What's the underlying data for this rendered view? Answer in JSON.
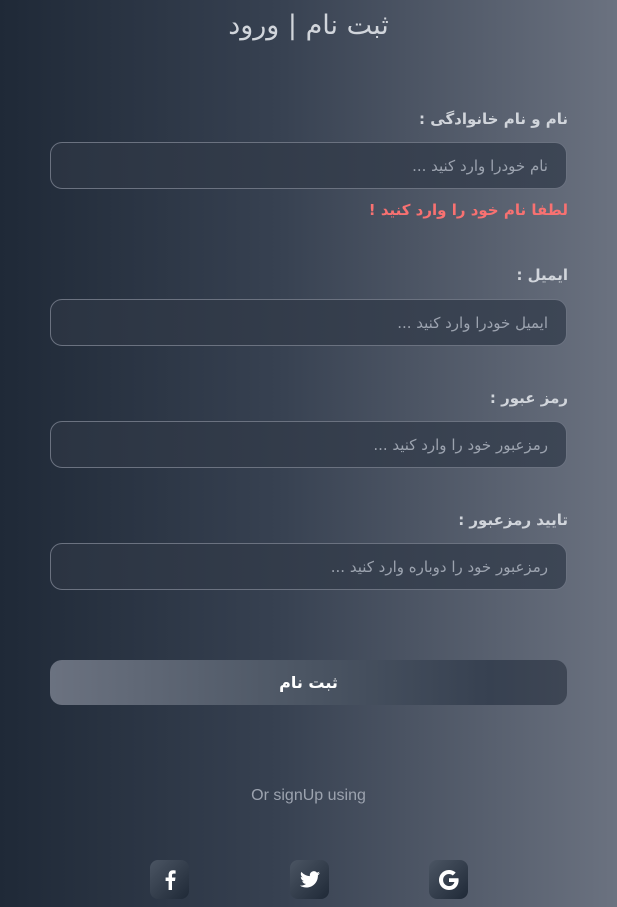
{
  "header": {
    "title": "ثبت نام | ورود"
  },
  "form": {
    "fields": [
      {
        "label": "نام و نام خانوادگی :",
        "placeholder": "نام خودرا وارد کنید ...",
        "value": ""
      },
      {
        "label": "ایمیل :",
        "placeholder": "ایمیل خودرا وارد کنید ...",
        "value": ""
      },
      {
        "label": "رمز عبور :",
        "placeholder": "رمزعبور خود را وارد کنید ...",
        "value": ""
      },
      {
        "label": "تایید رمزعبور :",
        "placeholder": "رمزعبور خود را دوباره وارد کنید ...",
        "value": ""
      }
    ],
    "error": "لطفا نام خود را وارد کنید !",
    "submit_label": "ثبت نام"
  },
  "social": {
    "title": "Or signUp using",
    "buttons": [
      {
        "icon": "facebook-icon"
      },
      {
        "icon": "twitter-icon"
      },
      {
        "icon": "google-icon"
      }
    ]
  },
  "colors": {
    "error": "#f87171",
    "label": "#d1d5db",
    "placeholder": "#9ca3af"
  }
}
